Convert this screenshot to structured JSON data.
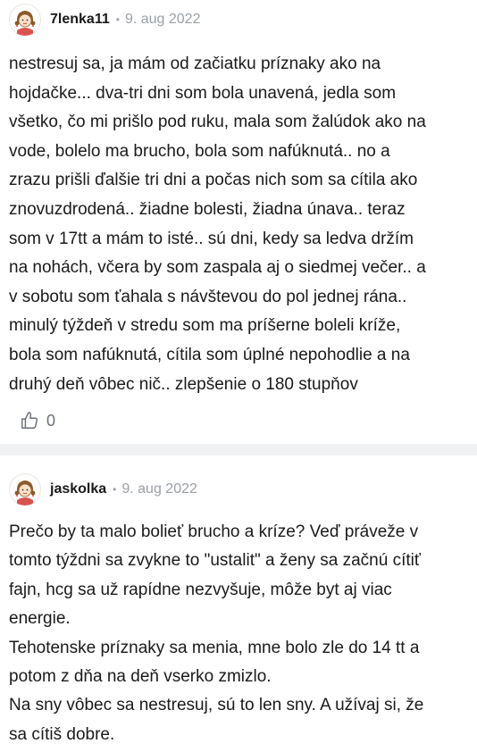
{
  "comments": [
    {
      "username": "7lenka11",
      "separator": "•",
      "date": "9. aug 2022",
      "lines": [
        "nestresuj sa, ja mám od začiatku príznaky ako na",
        "hojdačke... dva-tri dni som bola unavená, jedla som",
        "všetko, čo mi prišlo pod ruku, mala som žalúdok ako na",
        "vode, bolelo ma brucho, bola som nafúknutá.. no a",
        "zrazu prišli ďalšie tri dni a počas nich som sa cítila ako",
        "znovuzdrodená.. žiadne bolesti, žiadna únava.. teraz",
        "som v 17tt a mám to isté.. sú dni, kedy sa ledva držím",
        "na nohách, včera by som zaspala aj o siedmej večer.. a",
        "v sobotu som ťahala s návštevou do pol jednej rána..",
        "minulý týždeň v stredu som ma príšerne boleli kríže,",
        "bola som nafúknutá, cítila som úplné nepohodlie a na",
        "druhý deň vôbec nič.. zlepšenie o 180 stupňov"
      ],
      "like_count": "0",
      "like_icon": "thumbs-up-icon"
    },
    {
      "username": "jaskolka",
      "separator": "•",
      "date": "9. aug 2022",
      "lines": [
        "Prečo by ta malo bolieť brucho a kríze? Veď práveže v",
        "tomto týždni sa zvykne to \"ustalit\" a ženy sa začnú cítiť",
        "fajn, hcg sa už rapídne nezvyšuje, môže byt aj viac",
        "energie.",
        "Tehotenske príznaky sa menia, mne bolo zle do 14 tt a",
        "potom z dňa na deň vserko zmizlo.",
        "Na sny vôbec sa nestresuj, sú to len sny. A užívaj si, že",
        "sa cítiš dobre."
      ]
    }
  ],
  "colors": {
    "text": "#1a1a1a",
    "muted": "#9aa0a6",
    "separator_band": "#f0f1f3",
    "like_icon": "#6b7078"
  }
}
